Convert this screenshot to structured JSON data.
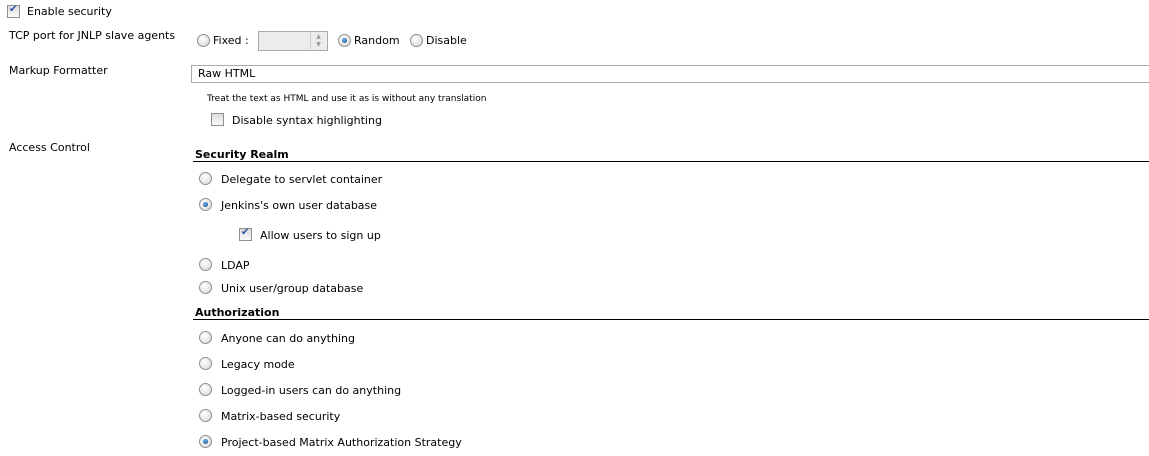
{
  "enable_security": {
    "label": "Enable security",
    "checked": true
  },
  "tcp": {
    "label": "TCP port for JNLP slave agents",
    "options": [
      "Fixed :",
      "Random",
      "Disable"
    ],
    "selected": "Random",
    "fixed_value": ""
  },
  "markup": {
    "label": "Markup Formatter",
    "value": "Raw HTML",
    "description": "Treat the text as HTML and use it as is without any translation",
    "disable_syntax": {
      "label": "Disable syntax highlighting",
      "checked": false
    }
  },
  "access_control": {
    "label": "Access Control",
    "security_realm": {
      "heading": "Security Realm",
      "options": [
        "Delegate to servlet container",
        "Jenkins's own user database",
        "LDAP",
        "Unix user/group database"
      ],
      "selected": "Jenkins's own user database",
      "allow_signup": {
        "label": "Allow users to sign up",
        "checked": true
      }
    },
    "authorization": {
      "heading": "Authorization",
      "options": [
        "Anyone can do anything",
        "Legacy mode",
        "Logged-in users can do anything",
        "Matrix-based security",
        "Project-based Matrix Authorization Strategy"
      ],
      "selected": "Project-based Matrix Authorization Strategy"
    }
  }
}
